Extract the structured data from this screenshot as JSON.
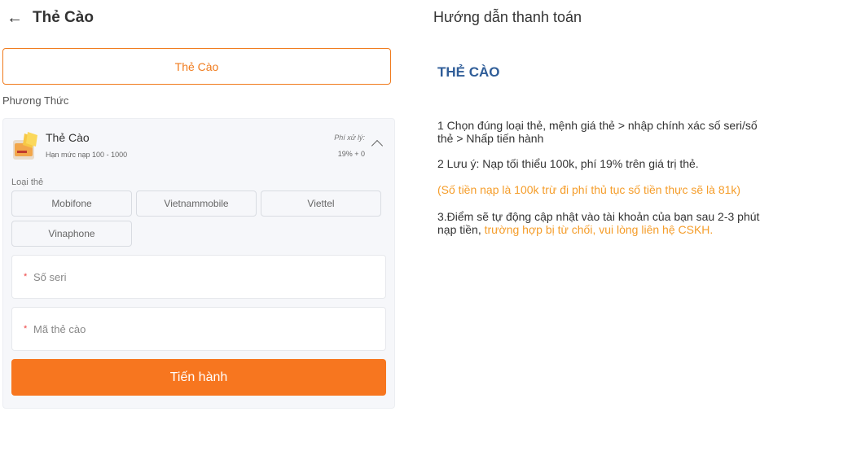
{
  "header": {
    "back_icon": "←",
    "title": "Thẻ Cào"
  },
  "tabs": [
    {
      "label": "Thẻ Cào",
      "active": true
    }
  ],
  "method_label": "Phương Thức",
  "card": {
    "name": "Thẻ Cào",
    "limit": "Hạn mức nạp 100 - 1000",
    "fee_label": "Phí xử lý:",
    "fee_value": "19% + 0",
    "icon": "card-icon",
    "expand_icon": "chevron-up-icon"
  },
  "card_type": {
    "label": "Loại thẻ",
    "options": [
      "Mobifone",
      "Vietnammobile",
      "Viettel",
      "Vinaphone"
    ]
  },
  "inputs": {
    "serial": {
      "required_mark": "*",
      "placeholder": "Số seri",
      "value": ""
    },
    "code": {
      "required_mark": "*",
      "placeholder": "Mã thẻ cào",
      "value": ""
    }
  },
  "submit_label": "Tiến hành",
  "guide": {
    "title": "Hướng dẫn thanh toán",
    "heading": "THẺ CÀO",
    "step1_line1": "1 Chọn đúng loại thẻ, mệnh giá thẻ > nhập chính xác số seri/số",
    "step1_line2": "thẻ > Nhấp tiến hành",
    "step2": "2 Lưu ý: Nạp tối thiểu 100k, phí 19% trên giá trị thẻ.",
    "note": "(Số tiền nạp là 100k trừ đi phí thủ tục số tiền thực sẽ là 81k)",
    "step3_line1": "3.Điểm sẽ tự động cập nhật vào tài khoản của bạn sau 2-3 phút",
    "step3_line2_prefix": "nạp tiền, ",
    "step3_line2_highlight": "trường hợp bị từ chối, vui lòng liên hệ CSKH.",
    "accent_color": "#f59d2a",
    "heading_color": "#2f5d98"
  },
  "colors": {
    "primary": "#f7761f",
    "tab_border": "#f07b1d"
  }
}
